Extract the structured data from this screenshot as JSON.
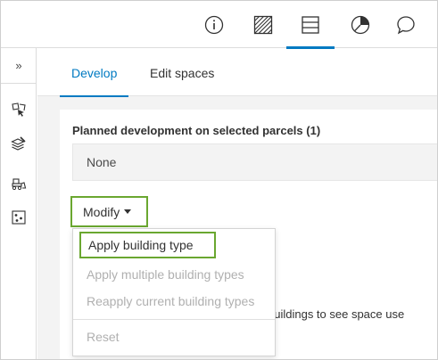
{
  "toolbar": {
    "tools": [
      {
        "icon": "info-icon"
      },
      {
        "icon": "hatch-pattern-icon"
      },
      {
        "icon": "table-icon",
        "active": true
      },
      {
        "icon": "pie-chart-icon"
      },
      {
        "icon": "comment-icon"
      }
    ],
    "accent_color": "#007ac2"
  },
  "rail": {
    "collapse_label": "»",
    "items": [
      {
        "icon": "select-parcels-icon"
      },
      {
        "icon": "layers-edit-icon"
      },
      {
        "icon": "bulldozer-icon"
      },
      {
        "icon": "scenario-points-icon"
      }
    ]
  },
  "tabs": [
    {
      "label": "Develop",
      "active": true
    },
    {
      "label": "Edit spaces",
      "active": false
    }
  ],
  "develop": {
    "heading": "Planned development on selected parcels (1)",
    "current_value": "None",
    "modify_label": "Modify",
    "highlight_color": "#6aa730"
  },
  "second_card": {
    "partial_text": "w buildings to see space use"
  },
  "menu": {
    "items": [
      {
        "label": "Apply building type",
        "enabled": true
      },
      {
        "label": "Apply multiple building types",
        "enabled": false
      },
      {
        "label": "Reapply current building types",
        "enabled": false
      },
      {
        "label": "Reset",
        "enabled": false
      }
    ]
  }
}
